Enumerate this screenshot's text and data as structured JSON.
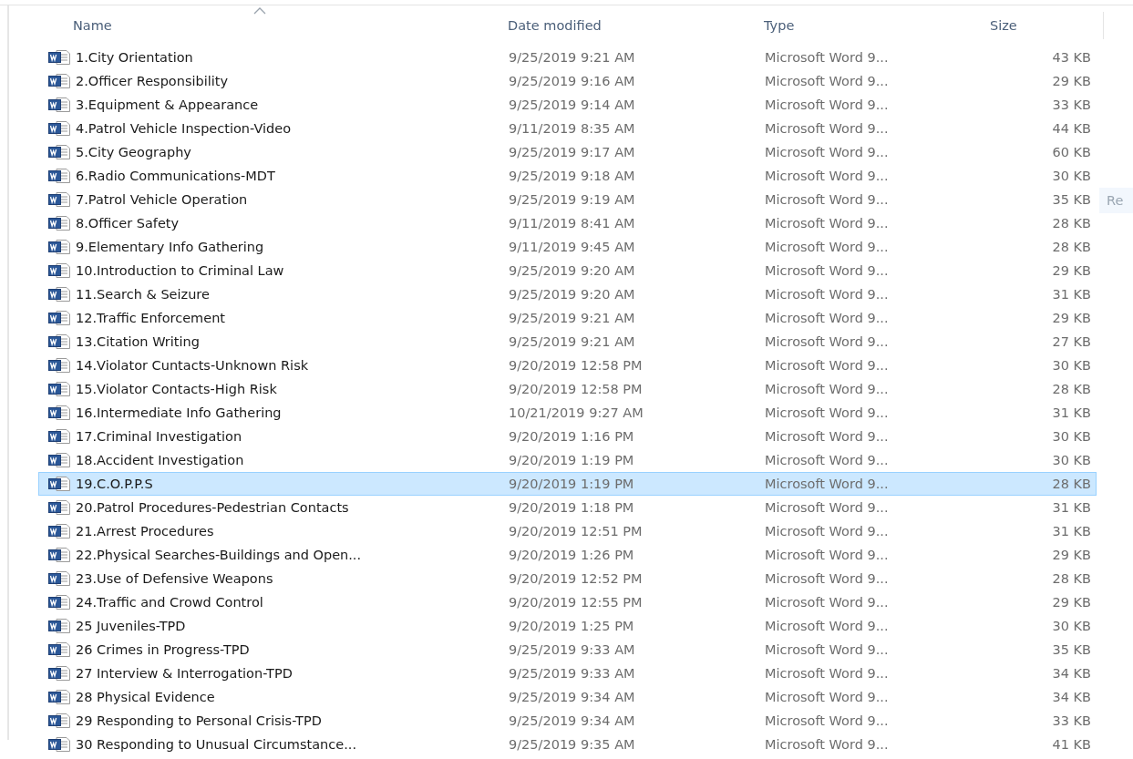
{
  "columns": [
    {
      "label": "Name",
      "sorted": true
    },
    {
      "label": "Date modified",
      "sorted": false
    },
    {
      "label": "Type",
      "sorted": false
    },
    {
      "label": "Size",
      "sorted": false
    }
  ],
  "rows": [
    {
      "name": "1.City Orientation",
      "date": "9/25/2019 9:21 AM",
      "type": "Microsoft Word 9...",
      "size": "43 KB",
      "selected": false
    },
    {
      "name": "2.Officer Responsibility",
      "date": "9/25/2019 9:16 AM",
      "type": "Microsoft Word 9...",
      "size": "29 KB",
      "selected": false
    },
    {
      "name": "3.Equipment & Appearance",
      "date": "9/25/2019 9:14 AM",
      "type": "Microsoft Word 9...",
      "size": "33 KB",
      "selected": false
    },
    {
      "name": "4.Patrol Vehicle Inspection-Video",
      "date": "9/11/2019 8:35 AM",
      "type": "Microsoft Word 9...",
      "size": "44 KB",
      "selected": false
    },
    {
      "name": "5.City Geography",
      "date": "9/25/2019 9:17 AM",
      "type": "Microsoft Word 9...",
      "size": "60 KB",
      "selected": false
    },
    {
      "name": "6.Radio Communications-MDT",
      "date": "9/25/2019 9:18 AM",
      "type": "Microsoft Word 9...",
      "size": "30 KB",
      "selected": false
    },
    {
      "name": "7.Patrol Vehicle Operation",
      "date": "9/25/2019 9:19 AM",
      "type": "Microsoft Word 9...",
      "size": "35 KB",
      "selected": false
    },
    {
      "name": "8.Officer Safety",
      "date": "9/11/2019 8:41 AM",
      "type": "Microsoft Word 9...",
      "size": "28 KB",
      "selected": false
    },
    {
      "name": "9.Elementary Info Gathering",
      "date": "9/11/2019 9:45 AM",
      "type": "Microsoft Word 9...",
      "size": "28 KB",
      "selected": false
    },
    {
      "name": "10.Introduction to Criminal Law",
      "date": "9/25/2019 9:20 AM",
      "type": "Microsoft Word 9...",
      "size": "29 KB",
      "selected": false
    },
    {
      "name": "11.Search & Seizure",
      "date": "9/25/2019 9:20 AM",
      "type": "Microsoft Word 9...",
      "size": "31 KB",
      "selected": false
    },
    {
      "name": "12.Traffic Enforcement",
      "date": "9/25/2019 9:21 AM",
      "type": "Microsoft Word 9...",
      "size": "29 KB",
      "selected": false
    },
    {
      "name": "13.Citation Writing",
      "date": "9/25/2019 9:21 AM",
      "type": "Microsoft Word 9...",
      "size": "27 KB",
      "selected": false
    },
    {
      "name": "14.Violator Cuntacts-Unknown Risk",
      "date": "9/20/2019 12:58 PM",
      "type": "Microsoft Word 9...",
      "size": "30 KB",
      "selected": false
    },
    {
      "name": "15.Violator Contacts-High Risk",
      "date": "9/20/2019 12:58 PM",
      "type": "Microsoft Word 9...",
      "size": "28 KB",
      "selected": false
    },
    {
      "name": "16.Intermediate Info Gathering",
      "date": "10/21/2019 9:27 AM",
      "type": "Microsoft Word 9...",
      "size": "31 KB",
      "selected": false
    },
    {
      "name": "17.Criminal Investigation",
      "date": "9/20/2019 1:16 PM",
      "type": "Microsoft Word 9...",
      "size": "30 KB",
      "selected": false
    },
    {
      "name": "18.Accident Investigation",
      "date": "9/20/2019 1:19 PM",
      "type": "Microsoft Word 9...",
      "size": "30 KB",
      "selected": false
    },
    {
      "name": "19.C.O.P.P.S",
      "date": "9/20/2019 1:19 PM",
      "type": "Microsoft Word 9...",
      "size": "28 KB",
      "selected": true
    },
    {
      "name": "20.Patrol Procedures-Pedestrian Contacts",
      "date": "9/20/2019 1:18 PM",
      "type": "Microsoft Word 9...",
      "size": "31 KB",
      "selected": false
    },
    {
      "name": "21.Arrest Procedures",
      "date": "9/20/2019 12:51 PM",
      "type": "Microsoft Word 9...",
      "size": "31 KB",
      "selected": false
    },
    {
      "name": "22.Physical Searches-Buildings and Open...",
      "date": "9/20/2019 1:26 PM",
      "type": "Microsoft Word 9...",
      "size": "29 KB",
      "selected": false
    },
    {
      "name": "23.Use of Defensive Weapons",
      "date": "9/20/2019 12:52 PM",
      "type": "Microsoft Word 9...",
      "size": "28 KB",
      "selected": false
    },
    {
      "name": "24.Traffic and Crowd Control",
      "date": "9/20/2019 12:55 PM",
      "type": "Microsoft Word 9...",
      "size": "29 KB",
      "selected": false
    },
    {
      "name": "25 Juveniles-TPD",
      "date": "9/20/2019 1:25 PM",
      "type": "Microsoft Word 9...",
      "size": "30 KB",
      "selected": false
    },
    {
      "name": "26 Crimes in Progress-TPD",
      "date": "9/25/2019 9:33 AM",
      "type": "Microsoft Word 9...",
      "size": "35 KB",
      "selected": false
    },
    {
      "name": "27 Interview & Interrogation-TPD",
      "date": "9/25/2019 9:33 AM",
      "type": "Microsoft Word 9...",
      "size": "34 KB",
      "selected": false
    },
    {
      "name": "28 Physical Evidence",
      "date": "9/25/2019 9:34 AM",
      "type": "Microsoft Word 9...",
      "size": "34 KB",
      "selected": false
    },
    {
      "name": "29 Responding to Personal Crisis-TPD",
      "date": "9/25/2019 9:34 AM",
      "type": "Microsoft Word 9...",
      "size": "33 KB",
      "selected": false
    },
    {
      "name": "30 Responding to Unusual Circumstance...",
      "date": "9/25/2019 9:35 AM",
      "type": "Microsoft Word 9...",
      "size": "41 KB",
      "selected": false
    }
  ],
  "ghost_tooltip": {
    "label": "Re"
  }
}
